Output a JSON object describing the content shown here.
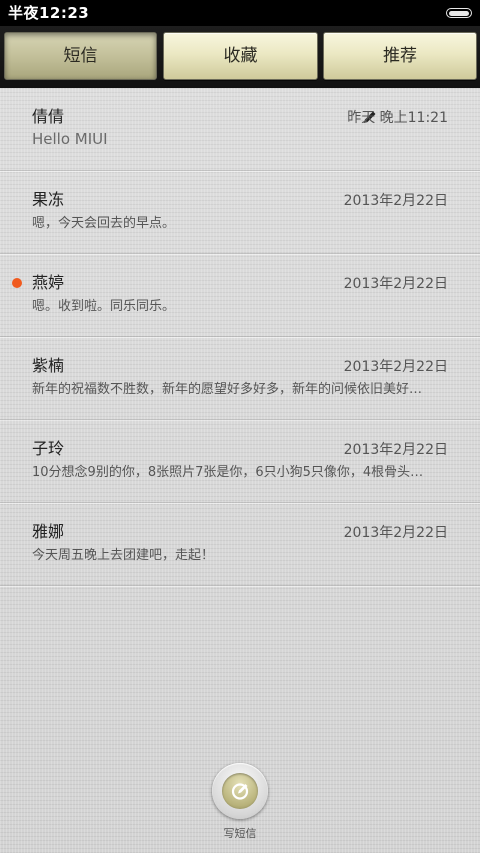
{
  "status_bar": {
    "time": "半夜12:23",
    "battery_icon": "battery-icon"
  },
  "tabs": [
    {
      "label": "短信",
      "active": true
    },
    {
      "label": "收藏",
      "active": false
    },
    {
      "label": "推荐",
      "active": false
    }
  ],
  "messages": [
    {
      "name": "倩倩",
      "date": "昨天 晚上11:21",
      "preview": "Hello MIUI",
      "draft": true,
      "unread": false
    },
    {
      "name": "果冻",
      "date": "2013年2月22日",
      "preview": "嗯，今天会回去的早点。",
      "draft": false,
      "unread": false
    },
    {
      "name": "燕婷",
      "date": "2013年2月22日",
      "preview": "嗯。收到啦。同乐同乐。",
      "draft": false,
      "unread": true
    },
    {
      "name": "紫楠",
      "date": "2013年2月22日",
      "preview": "新年的祝福数不胜数，新年的愿望好多好多，新年的问候依旧美好…",
      "draft": false,
      "unread": false
    },
    {
      "name": "子玲",
      "date": "2013年2月22日",
      "preview": "10分想念9别的你，8张照片7张是你，6只小狗5只像你，4根骨头…",
      "draft": false,
      "unread": false
    },
    {
      "name": "雅娜",
      "date": "2013年2月22日",
      "preview": "今天周五晚上去团建吧，走起！",
      "draft": false,
      "unread": false
    }
  ],
  "compose": {
    "label": "写短信",
    "icon": "compose-icon"
  },
  "colors": {
    "unread_dot": "#f05a1e",
    "tab_gold": "#ebe8c3",
    "status_bar": "#000000"
  }
}
